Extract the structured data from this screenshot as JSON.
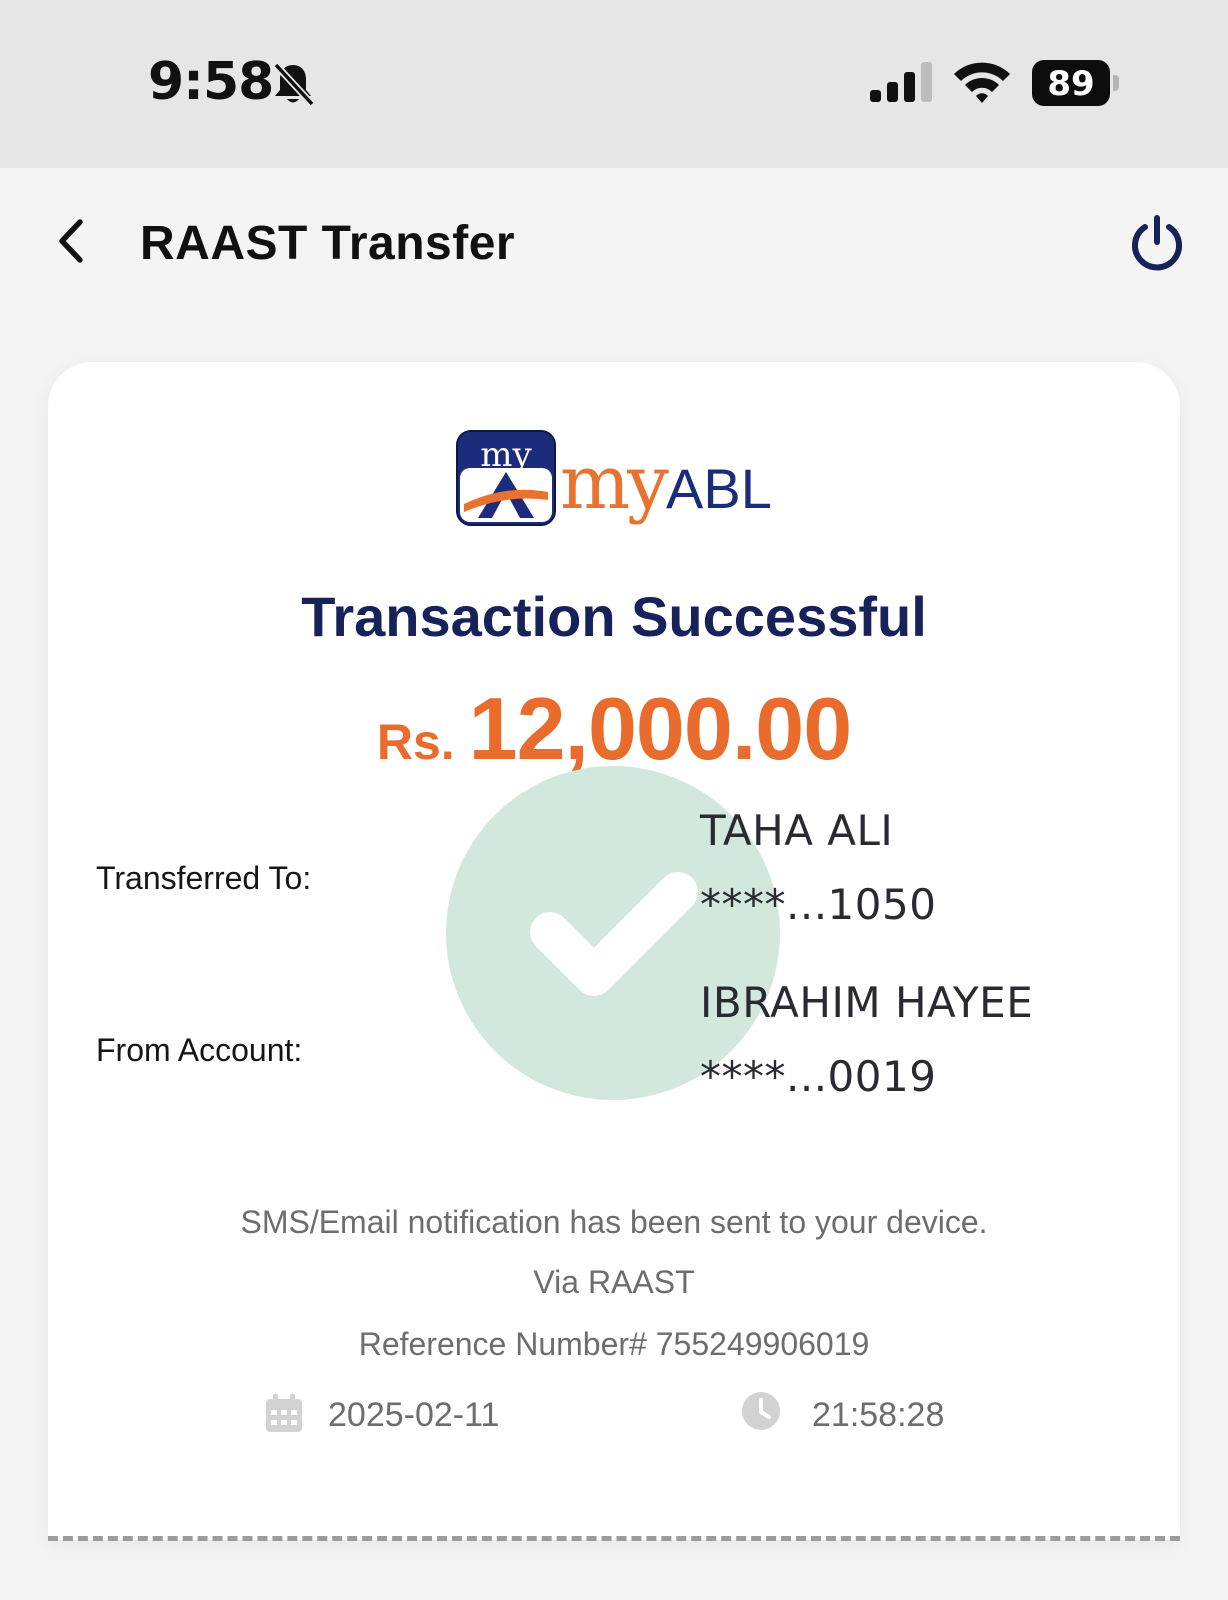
{
  "status_bar": {
    "time": "9:58",
    "battery_level": "89"
  },
  "header": {
    "title": "RAAST Transfer"
  },
  "logo": {
    "badge_text": "my",
    "brand_my": "my",
    "brand_abl": "ABL"
  },
  "receipt": {
    "status_title": "Transaction Successful",
    "currency": "Rs.",
    "amount": "12,000.00",
    "transferred_to_label": "Transferred To:",
    "beneficiary_name": "TAHA ALI",
    "beneficiary_account": "****...1050",
    "from_account_label": "From Account:",
    "sender_name": "IBRAHIM HAYEE",
    "sender_account": "****...0019",
    "notification_text": "SMS/Email notification has been sent to your device.",
    "channel_text": "Via RAAST",
    "reference_text": "Reference Number# 755249906019",
    "date": "2025-02-11",
    "time": "21:58:28"
  },
  "colors": {
    "brand_navy": "#17215a",
    "amount_orange": "#ea6c2d",
    "success_green": "#d3e8dc"
  }
}
